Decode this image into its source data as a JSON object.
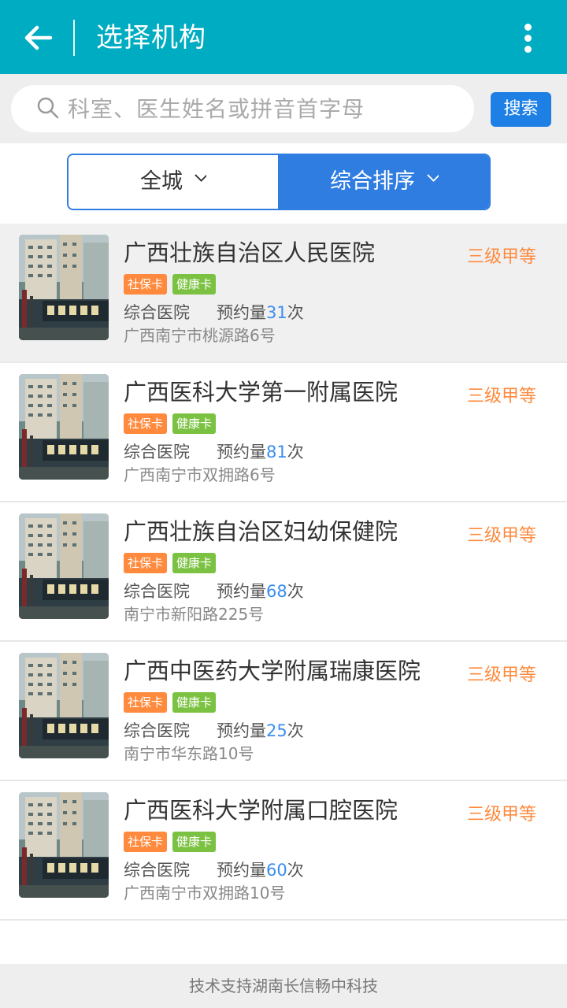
{
  "header": {
    "title": "选择机构"
  },
  "search": {
    "placeholder": "科室、医生姓名或拼音首字母",
    "button_label": "搜索"
  },
  "filters": {
    "area_label": "全城",
    "sort_label": "综合排序"
  },
  "list_labels": {
    "tag_social": "社保卡",
    "tag_health": "健康卡",
    "category": "综合医院",
    "count_prefix": "预约量",
    "count_suffix": "次"
  },
  "hospitals": [
    {
      "name": "广西壮族自治区人民医院",
      "level": "三级甲等",
      "count": "31",
      "address": "广西南宁市桃源路6号"
    },
    {
      "name": "广西医科大学第一附属医院",
      "level": "三级甲等",
      "count": "81",
      "address": "广西南宁市双拥路6号"
    },
    {
      "name": "广西壮族自治区妇幼保健院",
      "level": "三级甲等",
      "count": "68",
      "address": "南宁市新阳路225号"
    },
    {
      "name": "广西中医药大学附属瑞康医院",
      "level": "三级甲等",
      "count": "25",
      "address": "南宁市华东路10号"
    },
    {
      "name": "广西医科大学附属口腔医院",
      "level": "三级甲等",
      "count": "60",
      "address": "广西南宁市双拥路10号"
    }
  ],
  "footer": {
    "text": "技术支持湖南长信畅中科技"
  },
  "colors": {
    "header": "#00acc1",
    "accent_blue": "#2f7de1",
    "level_orange": "#ff8a3d",
    "tag_green": "#7cc242"
  }
}
